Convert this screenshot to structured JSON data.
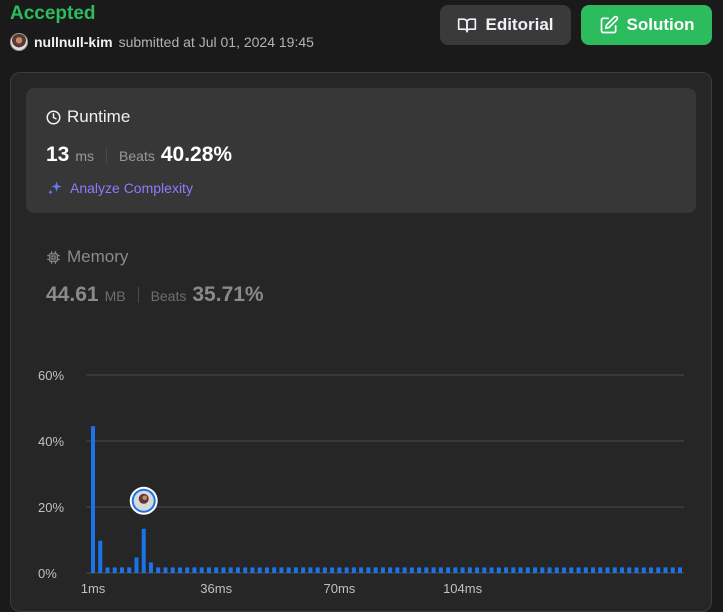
{
  "header": {
    "status": "Accepted",
    "username": "nullnull-kim",
    "submitted_text": "submitted at Jul 01, 2024 19:45",
    "editorial_label": "Editorial",
    "solution_label": "Solution"
  },
  "runtime": {
    "title": "Runtime",
    "value": "13",
    "unit": "ms",
    "beats_label": "Beats",
    "beats_value": "40.28%",
    "analyze_label": "Analyze Complexity"
  },
  "memory": {
    "title": "Memory",
    "value": "44.61",
    "unit": "MB",
    "beats_label": "Beats",
    "beats_value": "35.71%"
  },
  "colors": {
    "accepted": "#2cbb5d",
    "bar": "#1a73e8",
    "analyze": "#8a7dff"
  },
  "chart_data": {
    "type": "bar",
    "ylim": [
      0,
      60
    ],
    "yticks": [
      0,
      20,
      40,
      60
    ],
    "ytick_labels": [
      "0%",
      "20%",
      "40%",
      "60%"
    ],
    "xtick_labels": [
      "1ms",
      "36ms",
      "70ms",
      "104ms"
    ],
    "grid": true,
    "values": [
      44.5,
      9.8,
      1.7,
      1.7,
      1.7,
      1.7,
      4.7,
      13.4,
      3.2,
      1.7,
      1.7,
      1.7,
      1.7,
      1.7,
      1.7,
      1.7,
      1.7,
      1.7,
      1.7,
      1.7,
      1.7,
      1.7,
      1.7,
      1.7,
      1.7,
      1.7,
      1.7,
      1.7,
      1.7,
      1.7,
      1.7,
      1.7,
      1.7,
      1.7,
      1.7,
      1.7,
      1.7,
      1.7,
      1.7,
      1.7,
      1.7,
      1.7,
      1.7,
      1.7,
      1.7,
      1.7,
      1.7,
      1.7,
      1.7,
      1.7,
      1.7,
      1.7,
      1.7,
      1.7,
      1.7,
      1.7,
      1.7,
      1.7,
      1.7,
      1.7,
      1.7,
      1.7,
      1.7,
      1.7,
      1.7,
      1.7,
      1.7,
      1.7,
      1.7,
      1.7,
      1.7,
      1.7,
      1.7,
      1.7,
      1.7,
      1.7,
      1.7,
      1.7,
      1.7,
      1.7,
      1.7,
      1.7
    ],
    "user_bar_index": 7
  }
}
